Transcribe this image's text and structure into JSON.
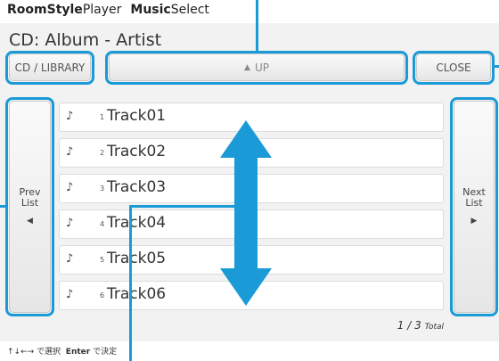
{
  "header": {
    "brand_bold": "RoomStyle",
    "brand_rest": "Player",
    "section_bold": "Music",
    "section_rest": "Select"
  },
  "content_title": "CD: Album - Artist",
  "toolbar": {
    "source_button": "CD / LIBRARY",
    "up_label": "UP",
    "up_arrow": "▲",
    "close_button": "CLOSE"
  },
  "sidebar": {
    "prev_label_1": "Prev",
    "prev_label_2": "List",
    "prev_arrow": "◀",
    "next_label_1": "Next",
    "next_label_2": "List",
    "next_arrow": "▶"
  },
  "tracks": [
    {
      "icon": "♪",
      "number": "1",
      "name": "Track01"
    },
    {
      "icon": "♪",
      "number": "2",
      "name": "Track02"
    },
    {
      "icon": "♪",
      "number": "3",
      "name": "Track03"
    },
    {
      "icon": "♪",
      "number": "4",
      "name": "Track04"
    },
    {
      "icon": "♪",
      "number": "5",
      "name": "Track05"
    },
    {
      "icon": "♪",
      "number": "6",
      "name": "Track06"
    }
  ],
  "pagination": {
    "current": "1",
    "separator": "/",
    "total": "3",
    "total_label": "Total"
  },
  "help": {
    "arrows": "↑↓←→",
    "select_text": "で選択",
    "enter_key": "Enter",
    "decide_text": "で決定"
  },
  "colors": {
    "highlight": "#1a9ad6"
  }
}
